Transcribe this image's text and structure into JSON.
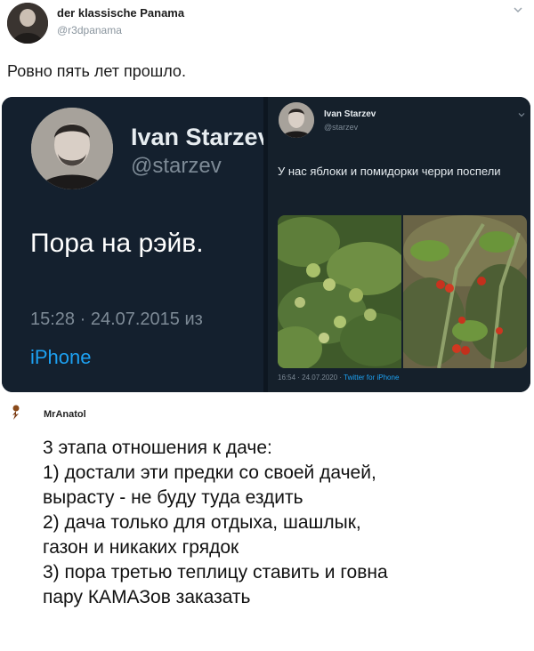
{
  "tweet": {
    "author_name": "der klassische Panama",
    "author_handle": "@r3dpanama",
    "text": "Ровно пять лет прошло.",
    "menu_icon": "chevron-down-icon"
  },
  "left_tweet": {
    "name": "Ivan Starzev",
    "handle": "@starzev",
    "text": "Пора на рэйв.",
    "timestamp": "15:28 · 24.07.2015 из",
    "source": "iPhone"
  },
  "right_tweet": {
    "name": "Ivan Starzev",
    "handle": "@starzev",
    "text": "У нас яблоки и помидорки черри поспели",
    "timestamp": "16:54 · 24.07.2020 · ",
    "source": "Twitter for iPhone",
    "menu_icon": "chevron-down-icon"
  },
  "comment": {
    "author": "MrAnatol",
    "lines": [
      "3 этапа отношения к даче:",
      "1) достали эти предки со своей дачей,",
      "вырасту - не буду туда ездить",
      "2) дача только для отдыха, шашлык,",
      "газон и никаких грядок",
      "3) пора третью теплицу ставить и говна",
      "пару КАМАЗов заказать"
    ]
  },
  "colors": {
    "twitter_dark_bg": "#15202b",
    "twitter_blue": "#1da1f2",
    "muted_gray": "#7d8a96"
  }
}
